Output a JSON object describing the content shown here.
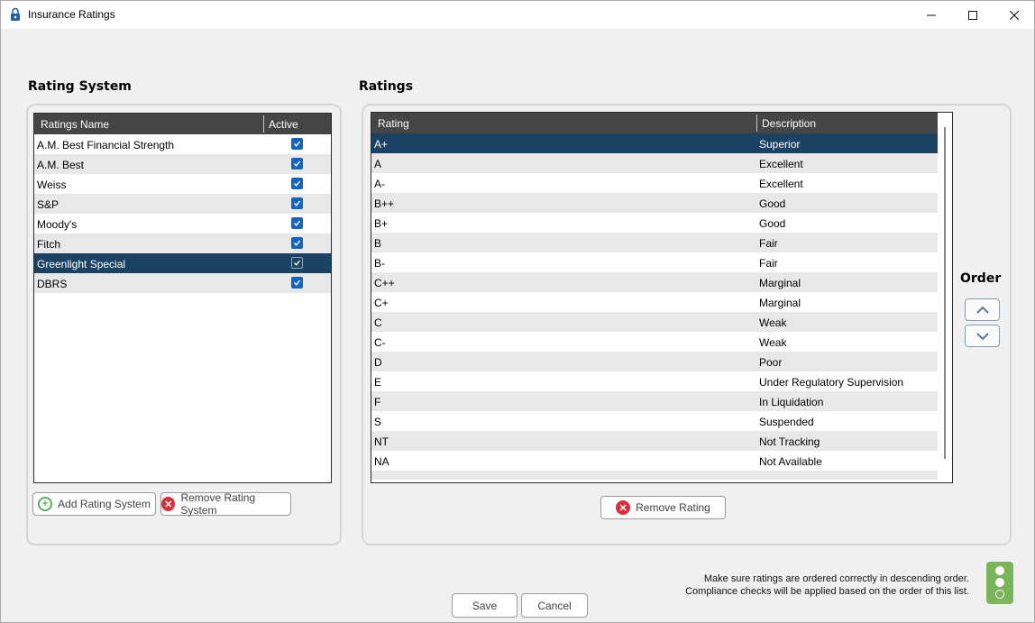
{
  "window": {
    "title": "Insurance Ratings",
    "minimize_glyph": "—",
    "maximize_glyph": "☐",
    "close_glyph": "✕"
  },
  "rating_system": {
    "title": "Rating System",
    "columns": [
      "Ratings Name",
      "Active"
    ],
    "rows": [
      {
        "name": "A.M. Best Financial Strength",
        "active": true
      },
      {
        "name": "A.M. Best",
        "active": true
      },
      {
        "name": "Weiss",
        "active": true
      },
      {
        "name": "S&P",
        "active": true
      },
      {
        "name": "Moody's",
        "active": true
      },
      {
        "name": "Fitch",
        "active": true
      },
      {
        "name": "Greenlight Special",
        "active": true,
        "selected": true
      },
      {
        "name": "DBRS",
        "active": true
      }
    ],
    "add_button": "Add Rating System",
    "remove_button": "Remove Rating System"
  },
  "ratings": {
    "title": "Ratings",
    "columns": [
      "Rating",
      "Description"
    ],
    "rows": [
      {
        "rating": "A+",
        "description": "Superior",
        "selected": true
      },
      {
        "rating": "A",
        "description": "Excellent"
      },
      {
        "rating": "A-",
        "description": "Excellent"
      },
      {
        "rating": "B++",
        "description": "Good"
      },
      {
        "rating": "B+",
        "description": "Good"
      },
      {
        "rating": "B",
        "description": "Fair"
      },
      {
        "rating": "B-",
        "description": "Fair"
      },
      {
        "rating": "C++",
        "description": "Marginal"
      },
      {
        "rating": "C+",
        "description": "Marginal"
      },
      {
        "rating": "C",
        "description": "Weak"
      },
      {
        "rating": "C-",
        "description": "Weak"
      },
      {
        "rating": "D",
        "description": "Poor"
      },
      {
        "rating": "E",
        "description": "Under Regulatory Supervision"
      },
      {
        "rating": "F",
        "description": "In Liquidation"
      },
      {
        "rating": "S",
        "description": "Suspended"
      },
      {
        "rating": "NT",
        "description": "Not Tracking"
      },
      {
        "rating": "NA",
        "description": "Not Available"
      }
    ],
    "remove_button": "Remove Rating"
  },
  "order": {
    "label": "Order",
    "up_icon": "chevron-up-icon",
    "down_icon": "chevron-down-icon"
  },
  "footer": {
    "note_line1": "Make sure ratings are ordered correctly in descending order.",
    "note_line2": "Compliance checks will be applied based on the order of this list.",
    "save_button": "Save",
    "cancel_button": "Cancel"
  },
  "colors": {
    "selected_row": "#1b4263",
    "header_bg": "#454545",
    "checkbox": "#1565c0",
    "traffic_light": "#7ab55c"
  }
}
